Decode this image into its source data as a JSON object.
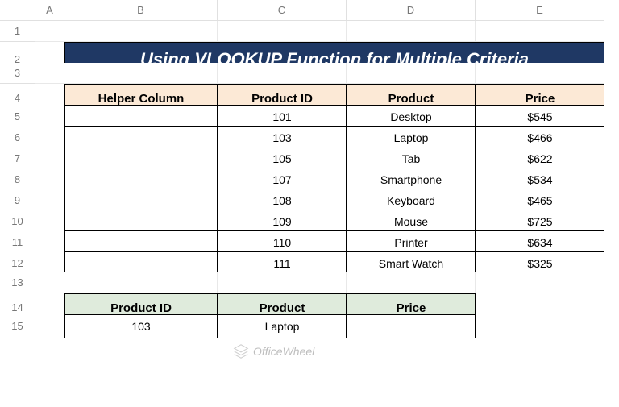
{
  "columns": [
    "A",
    "B",
    "C",
    "D",
    "E"
  ],
  "rows": [
    "1",
    "2",
    "3",
    "4",
    "5",
    "6",
    "7",
    "8",
    "9",
    "10",
    "11",
    "12",
    "13",
    "14",
    "15"
  ],
  "title": "Using VLOOKUP Function for Multiple Criteria",
  "table1": {
    "headers": [
      "Helper Column",
      "Product ID",
      "Product",
      "Price"
    ],
    "rows": [
      {
        "helper": "",
        "id": "101",
        "product": "Desktop",
        "price": "$545"
      },
      {
        "helper": "",
        "id": "103",
        "product": "Laptop",
        "price": "$466"
      },
      {
        "helper": "",
        "id": "105",
        "product": "Tab",
        "price": "$622"
      },
      {
        "helper": "",
        "id": "107",
        "product": "Smartphone",
        "price": "$534"
      },
      {
        "helper": "",
        "id": "108",
        "product": "Keyboard",
        "price": "$465"
      },
      {
        "helper": "",
        "id": "109",
        "product": "Mouse",
        "price": "$725"
      },
      {
        "helper": "",
        "id": "110",
        "product": "Printer",
        "price": "$634"
      },
      {
        "helper": "",
        "id": "111",
        "product": "Smart Watch",
        "price": "$325"
      }
    ]
  },
  "table2": {
    "headers": [
      "Product ID",
      "Product",
      "Price"
    ],
    "row": {
      "id": "103",
      "product": "Laptop",
      "price": ""
    }
  },
  "watermark": "OfficeWheel"
}
